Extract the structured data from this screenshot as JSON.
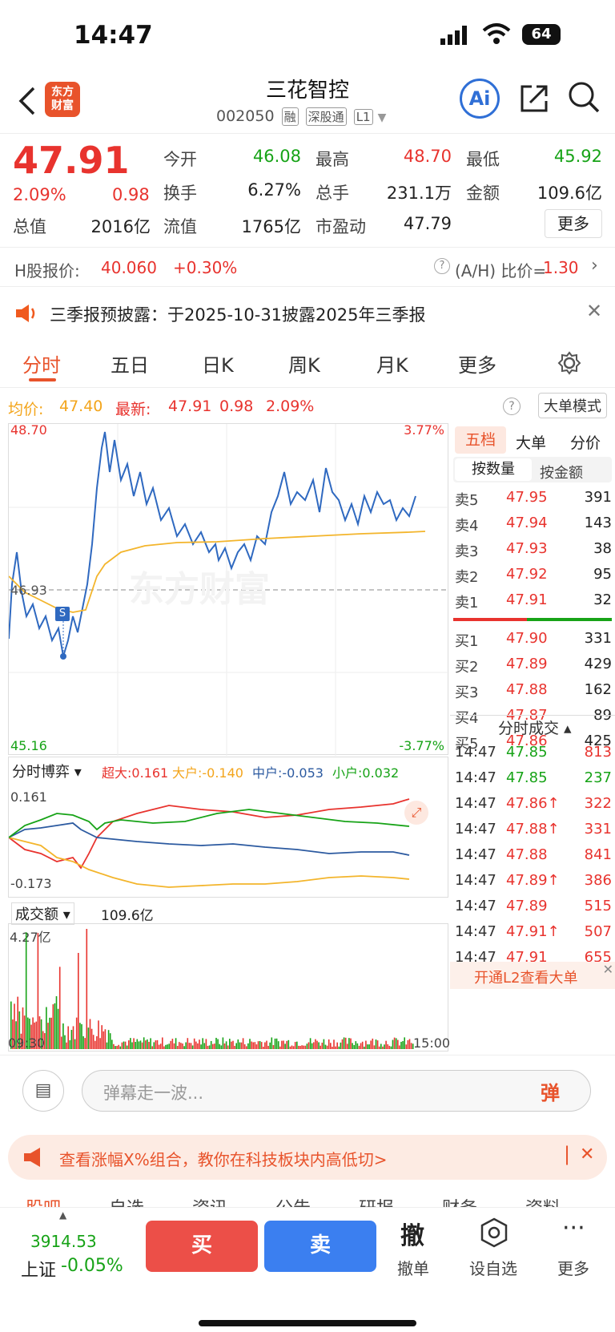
{
  "status": {
    "time": "14:47",
    "battery": "64"
  },
  "stock": {
    "name": "三花智控",
    "code": "002050",
    "tags": [
      "融",
      "深股通",
      "L1"
    ],
    "logo": "东方\n财富"
  },
  "quote": {
    "price": "47.91",
    "pct": "2.09%",
    "chg": "0.98",
    "cells": [
      {
        "l": "今开",
        "v": "46.08",
        "c": "green"
      },
      {
        "l": "最高",
        "v": "48.70",
        "c": "red"
      },
      {
        "l": "最低",
        "v": "45.92",
        "c": "green"
      },
      {
        "l": "换手",
        "v": "6.27%",
        "c": ""
      },
      {
        "l": "总手",
        "v": "231.1万",
        "c": ""
      },
      {
        "l": "金额",
        "v": "109.6亿",
        "c": ""
      },
      {
        "l": "总值",
        "v": "2016亿",
        "c": ""
      },
      {
        "l": "流值",
        "v": "1765亿",
        "c": ""
      },
      {
        "l": "市盈动",
        "v": "47.79",
        "c": ""
      }
    ],
    "more": "更多"
  },
  "hshare": {
    "label": "H股报价:",
    "price": "40.060",
    "chg": "+0.30%",
    "ratio_label": "(A/H) 比价=",
    "ratio": "1.30"
  },
  "notice": {
    "text": "三季报预披露：于2025-10-31披露2025年三季报"
  },
  "tabs": [
    "分时",
    "五日",
    "日K",
    "周K",
    "月K",
    "更多"
  ],
  "info": {
    "avg_label": "均价:",
    "avg": "47.40",
    "latest_label": "最新:",
    "latest": "47.91",
    "chg": "0.98",
    "pct": "2.09%",
    "mode": "大单模式"
  },
  "chart": {
    "ymax": "48.70",
    "ymin": "45.16",
    "pmax": "3.77%",
    "pmin": "-3.77%",
    "mid": "46.93",
    "watermark": "东方财富",
    "marker": "S"
  },
  "flow": {
    "title": "分时博弈",
    "chao": "超大:0.161",
    "da": "大户:-0.140",
    "zhong": "中户:-0.053",
    "xiao": "小户:0.032",
    "top": "0.161",
    "bot": "-0.173"
  },
  "vol": {
    "title": "成交额",
    "total": "109.6亿",
    "max": "4.27亿",
    "start": "09:30",
    "end": "15:00"
  },
  "orderbook": {
    "tabs": [
      "五档",
      "大单",
      "分价"
    ],
    "subtabs": [
      "按数量",
      "按金额"
    ],
    "asks": [
      {
        "l": "卖5",
        "p": "47.95",
        "q": "391"
      },
      {
        "l": "卖4",
        "p": "47.94",
        "q": "143"
      },
      {
        "l": "卖3",
        "p": "47.93",
        "q": "38"
      },
      {
        "l": "卖2",
        "p": "47.92",
        "q": "95"
      },
      {
        "l": "卖1",
        "p": "47.91",
        "q": "32"
      }
    ],
    "bids": [
      {
        "l": "买1",
        "p": "47.90",
        "q": "331"
      },
      {
        "l": "买2",
        "p": "47.89",
        "q": "429"
      },
      {
        "l": "买3",
        "p": "47.88",
        "q": "162"
      },
      {
        "l": "买4",
        "p": "47.87",
        "q": "89"
      },
      {
        "l": "买5",
        "p": "47.86",
        "q": "425"
      }
    ],
    "trades_title": "分时成交",
    "trades": [
      {
        "t": "14:47",
        "p": "47.85",
        "q": "813",
        "c": "green",
        "q_c": "red"
      },
      {
        "t": "14:47",
        "p": "47.85",
        "q": "237",
        "c": "green",
        "q_c": "green"
      },
      {
        "t": "14:47",
        "p": "47.86↑",
        "q": "322",
        "c": "red",
        "q_c": "red"
      },
      {
        "t": "14:47",
        "p": "47.88↑",
        "q": "331",
        "c": "red",
        "q_c": "red"
      },
      {
        "t": "14:47",
        "p": "47.88",
        "q": "841",
        "c": "red",
        "q_c": "red"
      },
      {
        "t": "14:47",
        "p": "47.89↑",
        "q": "386",
        "c": "red",
        "q_c": "red"
      },
      {
        "t": "14:47",
        "p": "47.89",
        "q": "515",
        "c": "red",
        "q_c": "red"
      },
      {
        "t": "14:47",
        "p": "47.91↑",
        "q": "507",
        "c": "red",
        "q_c": "red"
      },
      {
        "t": "14:47",
        "p": "47.91",
        "q": "655",
        "c": "red",
        "q_c": "red"
      }
    ],
    "l2": "开通L2查看大单"
  },
  "danmu": {
    "placeholder": "弹幕走一波...",
    "btn": "弹"
  },
  "promo": {
    "text": "查看涨幅X%组合，教你在科技板块内高低切>"
  },
  "subnav": [
    "股吧",
    "自选",
    "资讯",
    "公告",
    "研报",
    "财务",
    "资料"
  ],
  "bottom": {
    "index_val": "3914.53",
    "index_name": "上证",
    "index_chg": "-0.05%",
    "buy": "买",
    "sell": "卖",
    "cancel_icon": "撤",
    "cancel": "撤单",
    "watch": "设自选",
    "more": "更多"
  }
}
